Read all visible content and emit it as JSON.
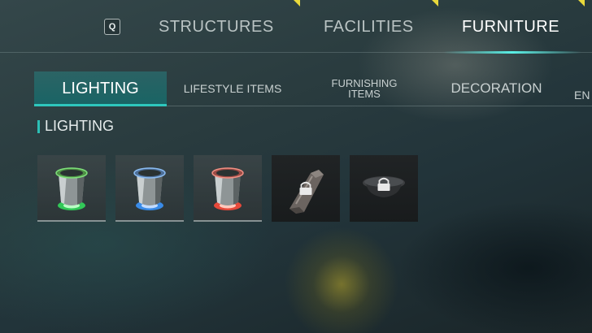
{
  "top_nav": {
    "key_hint": "Q",
    "tabs": [
      {
        "label": "STRUCTURES",
        "active": false
      },
      {
        "label": "FACILITIES",
        "active": false
      },
      {
        "label": "FURNITURE",
        "active": true
      }
    ]
  },
  "sub_nav": {
    "tabs": [
      {
        "label": "LIGHTING",
        "active": true
      },
      {
        "label": "LIFESTYLE ITEMS",
        "active": false
      },
      {
        "label_line1": "FURNISHING",
        "label_line2": "ITEMS",
        "active": false
      },
      {
        "label": "DECORATION",
        "active": false
      },
      {
        "label": "EN",
        "active": false
      }
    ]
  },
  "section": {
    "title": "LIGHTING"
  },
  "items": [
    {
      "icon": "green-ceiling-light-icon",
      "glow_color": "#33d05a",
      "locked": false
    },
    {
      "icon": "blue-ceiling-light-icon",
      "glow_color": "#3a8ff0",
      "locked": false
    },
    {
      "icon": "red-ceiling-light-icon",
      "glow_color": "#f04a3a",
      "locked": false
    },
    {
      "icon": "wall-lamp-icon",
      "locked": true
    },
    {
      "icon": "dome-lamp-icon",
      "locked": true
    }
  ],
  "colors": {
    "accent": "#2ec7bd",
    "highlight": "#e9d93b"
  }
}
